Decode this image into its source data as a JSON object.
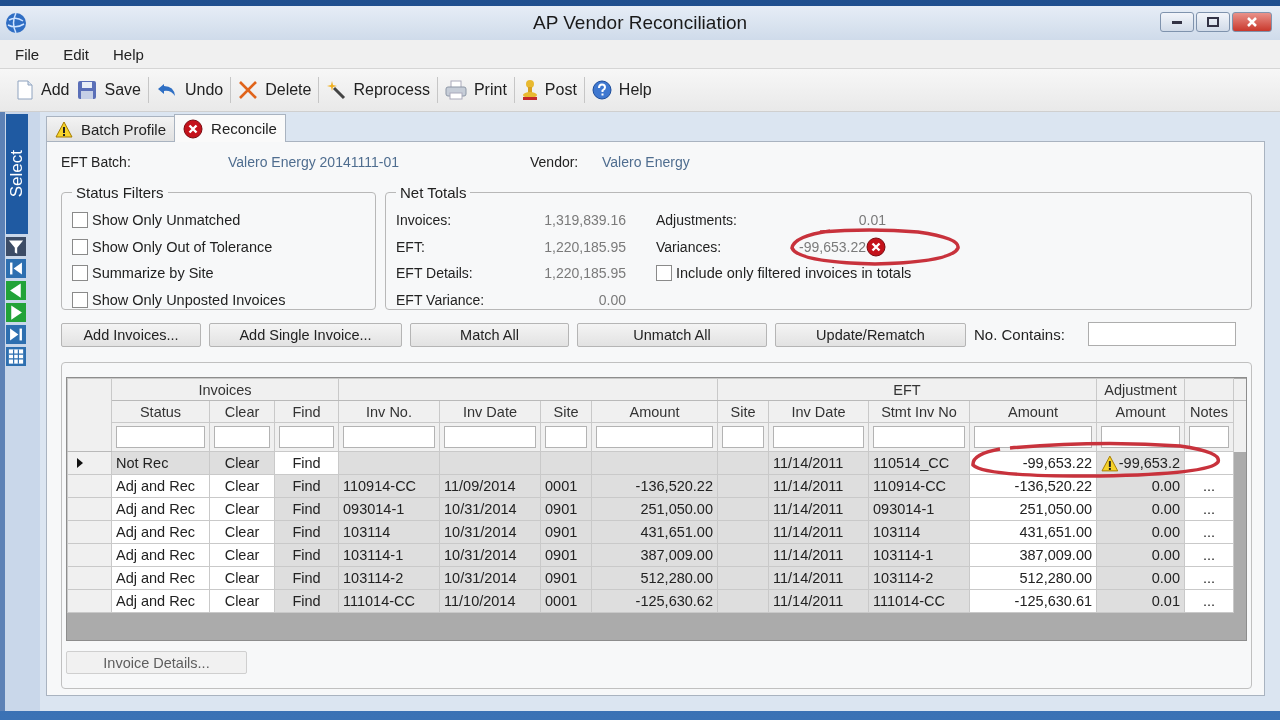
{
  "window": {
    "title": "AP Vendor Reconciliation"
  },
  "menu": [
    "File",
    "Edit",
    "Help"
  ],
  "toolbar": [
    "Add",
    "Save",
    "Undo",
    "Delete",
    "Reprocess",
    "Print",
    "Post",
    "Help"
  ],
  "side_strip": {
    "label": "Select"
  },
  "tabs": [
    {
      "label": "Batch Profile",
      "selected": false
    },
    {
      "label": "Reconcile",
      "selected": true
    }
  ],
  "header": {
    "eft_batch_label": "EFT Batch:",
    "eft_batch": "Valero Energy 20141111-01",
    "vendor_label": "Vendor:",
    "vendor": "Valero Energy"
  },
  "status_filters": {
    "title": "Status Filters",
    "items": [
      {
        "label": "Show Only Unmatched",
        "checked": false
      },
      {
        "label": "Show Only Out of Tolerance",
        "checked": false
      },
      {
        "label": "Summarize by Site",
        "checked": false
      },
      {
        "label": "Show Only Unposted Invoices",
        "checked": false
      }
    ]
  },
  "net_totals": {
    "title": "Net Totals",
    "left": [
      {
        "label": "Invoices:",
        "value": "1,319,839.16"
      },
      {
        "label": "EFT:",
        "value": "1,220,185.95"
      },
      {
        "label": "EFT Details:",
        "value": "1,220,185.95"
      },
      {
        "label": "EFT Variance:",
        "value": "0.00"
      }
    ],
    "right": [
      {
        "label": "Adjustments:",
        "value": "0.01",
        "error": false
      },
      {
        "label": "Variances:",
        "value": "-99,653.22",
        "error": true
      }
    ],
    "filter_checkbox": {
      "label": "Include only filtered invoices in totals",
      "checked": false
    }
  },
  "buttons": [
    "Add Invoices...",
    "Add Single Invoice...",
    "Match All",
    "Unmatch All",
    "Update/Rematch"
  ],
  "search": {
    "label": "No. Contains:"
  },
  "grid": {
    "group_headers": [
      "Invoices",
      "EFT",
      "Adjustment"
    ],
    "columns": [
      {
        "label": "Status",
        "kind": "text"
      },
      {
        "label": "Clear",
        "kind": "button"
      },
      {
        "label": "Find",
        "kind": "button"
      },
      {
        "label": "Inv No.",
        "kind": "text"
      },
      {
        "label": "Inv Date",
        "kind": "text"
      },
      {
        "label": "Site",
        "kind": "text"
      },
      {
        "label": "Amount",
        "kind": "number"
      },
      {
        "label": "Site",
        "kind": "text"
      },
      {
        "label": "Inv Date",
        "kind": "text"
      },
      {
        "label": "Stmt Inv No",
        "kind": "text"
      },
      {
        "label": "Amount",
        "kind": "number"
      },
      {
        "label": "Amount",
        "kind": "number"
      },
      {
        "label": "Notes",
        "kind": "button"
      }
    ],
    "rows": [
      {
        "selected": true,
        "warning": true,
        "cells": [
          "Not Rec",
          "Clear",
          "Find",
          null,
          null,
          null,
          null,
          null,
          "11/14/2011",
          "110514_CC",
          "-99,653.22",
          "-99,653.2",
          null
        ]
      },
      {
        "selected": false,
        "warning": false,
        "cells": [
          "Adj and Rec",
          "Clear",
          "Find",
          "110914-CC",
          "11/09/2014",
          "0001",
          "-136,520.22",
          null,
          "11/14/2011",
          "110914-CC",
          "-136,520.22",
          "0.00",
          "..."
        ]
      },
      {
        "selected": false,
        "warning": false,
        "cells": [
          "Adj and Rec",
          "Clear",
          "Find",
          "093014-1",
          "10/31/2014",
          "0901",
          "251,050.00",
          null,
          "11/14/2011",
          "093014-1",
          "251,050.00",
          "0.00",
          "..."
        ]
      },
      {
        "selected": false,
        "warning": false,
        "cells": [
          "Adj and Rec",
          "Clear",
          "Find",
          "103114",
          "10/31/2014",
          "0901",
          "431,651.00",
          null,
          "11/14/2011",
          "103114",
          "431,651.00",
          "0.00",
          "..."
        ]
      },
      {
        "selected": false,
        "warning": false,
        "cells": [
          "Adj and Rec",
          "Clear",
          "Find",
          "103114-1",
          "10/31/2014",
          "0901",
          "387,009.00",
          null,
          "11/14/2011",
          "103114-1",
          "387,009.00",
          "0.00",
          "..."
        ]
      },
      {
        "selected": false,
        "warning": false,
        "cells": [
          "Adj and Rec",
          "Clear",
          "Find",
          "103114-2",
          "10/31/2014",
          "0901",
          "512,280.00",
          null,
          "11/14/2011",
          "103114-2",
          "512,280.00",
          "0.00",
          "..."
        ]
      },
      {
        "selected": false,
        "warning": false,
        "cells": [
          "Adj and Rec",
          "Clear",
          "Find",
          "111014-CC",
          "11/10/2014",
          "0001",
          "-125,630.62",
          null,
          "11/14/2011",
          "111014-CC",
          "-125,630.61",
          "0.01",
          "..."
        ]
      }
    ]
  },
  "footer_button": {
    "label": "Invoice Details...",
    "disabled": true
  }
}
